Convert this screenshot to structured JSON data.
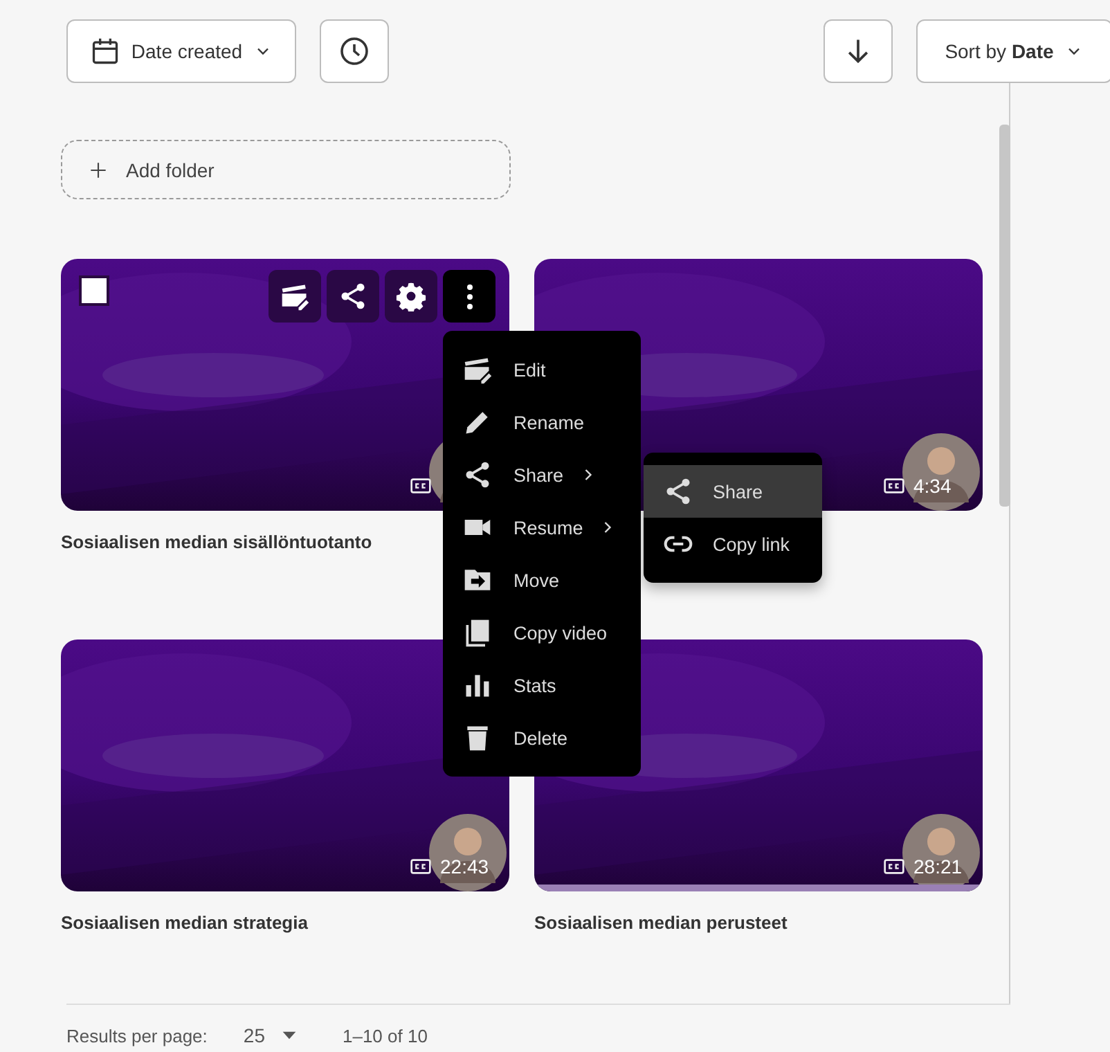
{
  "toolbar": {
    "date_filter": {
      "label": "Date created"
    },
    "sort": {
      "label": "Sort by **Date**"
    }
  },
  "add_folder": {
    "label": "Add folder"
  },
  "videos": [
    {
      "title": "Sosiaalisen median sisällöntuotanto",
      "captions": true,
      "hovered": true,
      "selected": false
    },
    {
      "duration": "4:34",
      "captions": true,
      "hovered": false
    },
    {
      "title": "Sosiaalisen median strategia",
      "duration": "22:43",
      "captions": true,
      "hovered": false
    },
    {
      "title": "Sosiaalisen median perusteet",
      "duration": "28:21",
      "captions": true,
      "hovered": false,
      "progress": {
        "level": 1
      }
    }
  ],
  "context_menu": {
    "items": [
      {
        "label": "Edit",
        "submenu": false
      },
      {
        "label": "Rename",
        "submenu": false
      },
      {
        "label": "Share",
        "submenu": true
      },
      {
        "label": "Resume",
        "submenu": true
      },
      {
        "label": "Move",
        "submenu": false
      },
      {
        "label": "Copy video",
        "submenu": false
      },
      {
        "label": "Stats",
        "submenu": false
      },
      {
        "label": "Delete",
        "submenu": false
      }
    ]
  },
  "share_submenu": {
    "items": [
      {
        "label": "Share",
        "selected": true
      },
      {
        "label": "Copy link",
        "selected": false
      }
    ]
  },
  "footer": {
    "label": "Results per page:",
    "per_page": "25",
    "range": "1–10 of 10"
  }
}
